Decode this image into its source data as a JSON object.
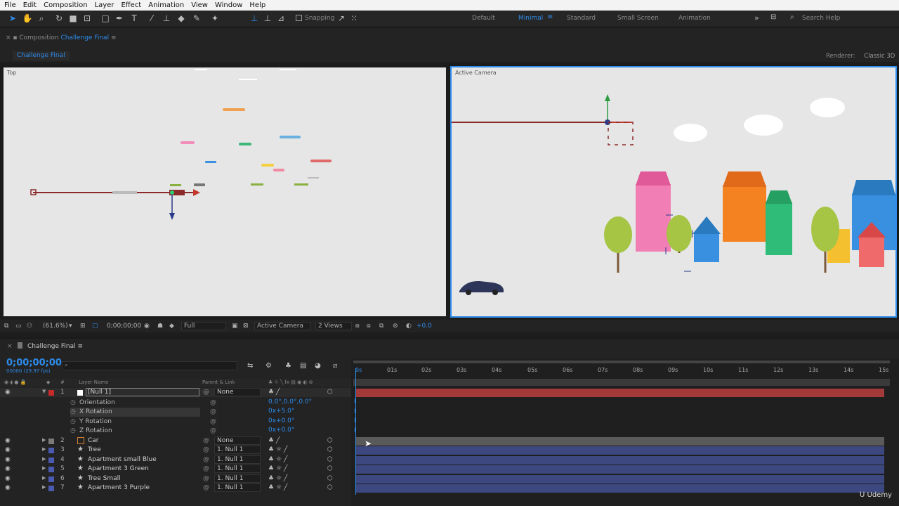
{
  "menu": [
    "File",
    "Edit",
    "Composition",
    "Layer",
    "Effect",
    "Animation",
    "View",
    "Window",
    "Help"
  ],
  "toolbar": {
    "snapping": "Snapping",
    "workspaces": [
      "Default",
      "Minimal",
      "Standard",
      "Small Screen",
      "Animation"
    ],
    "active_workspace": "Minimal",
    "search_placeholder": "Search Help"
  },
  "composition": {
    "tab_prefix": "Composition",
    "name": "Challenge Final",
    "breadcrumb": "Challenge Final",
    "renderer_label": "Renderer:",
    "renderer_value": "Classic 3D"
  },
  "viewers": {
    "left_label": "Top",
    "right_label": "Active Camera"
  },
  "viewer_footer": {
    "zoom": "(61.6%)",
    "timecode": "0;00;00;00",
    "resolution": "Full",
    "camera": "Active Camera",
    "views": "2 Views",
    "exposure": "+0.0"
  },
  "timeline": {
    "tab": "Challenge Final",
    "timecode": "0;00;00;00",
    "timecode_sub": "00000 (29.97 fps)",
    "columns": {
      "layer_name": "Layer Name",
      "parent": "Parent & Link"
    },
    "ruler": [
      "0s",
      "01s",
      "02s",
      "03s",
      "04s",
      "05s",
      "06s",
      "07s",
      "08s",
      "09s",
      "10s",
      "11s",
      "12s",
      "13s",
      "14s",
      "15s"
    ],
    "layers": [
      {
        "num": "1",
        "name": "[Null 1]",
        "parent": "None",
        "color": "#c62a2a"
      },
      {
        "num": "2",
        "name": "Car",
        "parent": "None",
        "color": "#7a7a7a"
      },
      {
        "num": "3",
        "name": "Tree",
        "parent": "1. Null 1",
        "color": "#4a5ab0"
      },
      {
        "num": "4",
        "name": "Apartment small Blue",
        "parent": "1. Null 1",
        "color": "#4a5ab0"
      },
      {
        "num": "5",
        "name": "Apartment 3 Green",
        "parent": "1. Null 1",
        "color": "#4a5ab0"
      },
      {
        "num": "6",
        "name": "Tree Small",
        "parent": "1. Null 1",
        "color": "#4a5ab0"
      },
      {
        "num": "7",
        "name": "Apartment 3 Purple",
        "parent": "1. Null 1",
        "color": "#4a5ab0"
      }
    ],
    "properties": [
      {
        "name": "Orientation",
        "value": "0.0°,0.0°,0.0°"
      },
      {
        "name": "X Rotation",
        "value": "0x+5.0°"
      },
      {
        "name": "Y Rotation",
        "value": "0x+0.0°"
      },
      {
        "name": "Z Rotation",
        "value": "0x+0.0°"
      }
    ]
  },
  "watermark": "Udemy"
}
